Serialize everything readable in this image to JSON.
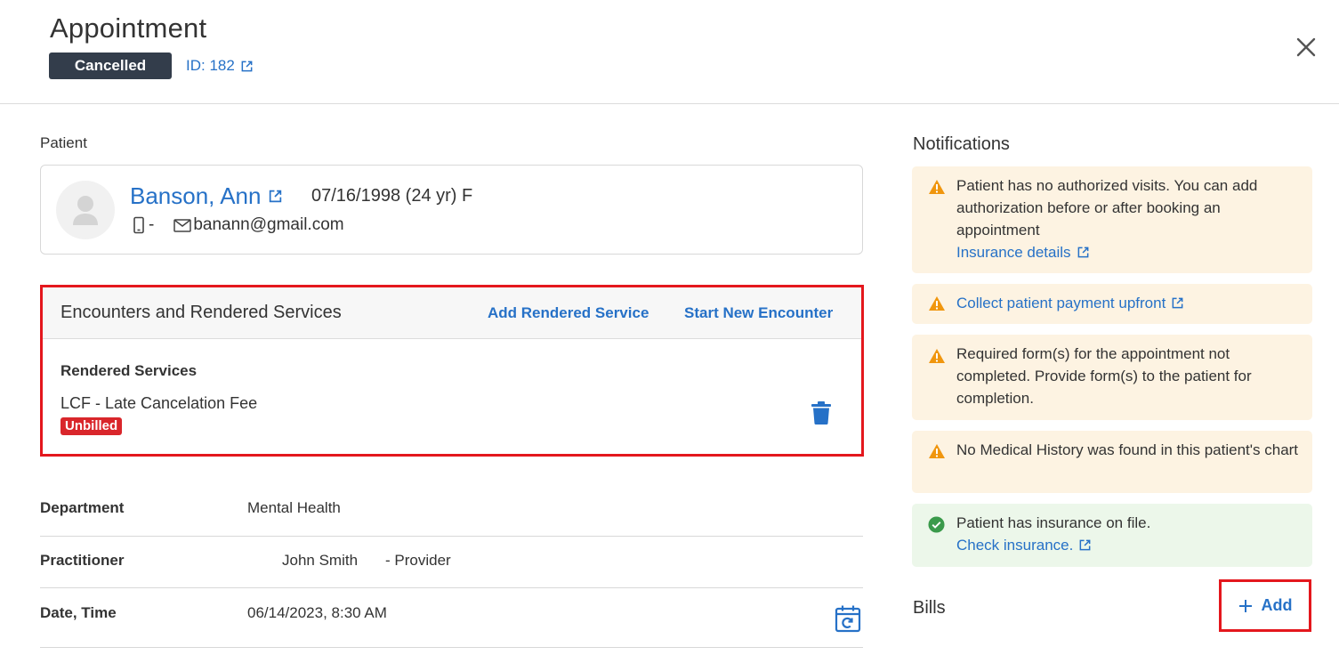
{
  "header": {
    "title": "Appointment",
    "status": "Cancelled",
    "id_label": "ID: 182"
  },
  "patient": {
    "section_label": "Patient",
    "name": "Banson, Ann",
    "dob": "07/16/1998 (24 yr) F",
    "phone": "-",
    "email": "banann@gmail.com"
  },
  "encounters": {
    "title": "Encounters and Rendered Services",
    "add_rendered_service": "Add Rendered Service",
    "start_new_encounter": "Start New Encounter",
    "rendered_services_label": "Rendered Services",
    "item": "LCF - Late Cancelation Fee",
    "item_status": "Unbilled"
  },
  "details": {
    "department_label": "Department",
    "department_value": "Mental Health",
    "practitioner_label": "Practitioner",
    "practitioner_name": "John Smith",
    "practitioner_role": "- Provider",
    "datetime_label": "Date, Time",
    "datetime_value": "06/14/2023, 8:30 AM"
  },
  "notifications": {
    "title": "Notifications",
    "items": [
      {
        "text": "Patient has no authorized visits. You can add authorization before or after booking an appointment",
        "link": "Insurance details",
        "kind": "warning"
      },
      {
        "link": "Collect patient payment upfront",
        "kind": "warning"
      },
      {
        "text": "Required form(s) for the appointment not completed. Provide form(s) to the patient for completion.",
        "kind": "warning"
      },
      {
        "text": "No Medical History was found in this patient's chart",
        "kind": "warning"
      },
      {
        "text": "Patient has insurance on file.",
        "link": "Check insurance.",
        "kind": "success"
      }
    ]
  },
  "bills": {
    "title": "Bills",
    "add_label": "Add"
  },
  "colors": {
    "link": "#2671c7",
    "badge_dark": "#333d4b",
    "unbilled": "#d9262b",
    "highlight": "#e4171d",
    "warning_bg": "#fdf3e2",
    "warning_icon": "#f0960e",
    "success_bg": "#ecf7ea",
    "success_icon": "#3a9a4b"
  }
}
